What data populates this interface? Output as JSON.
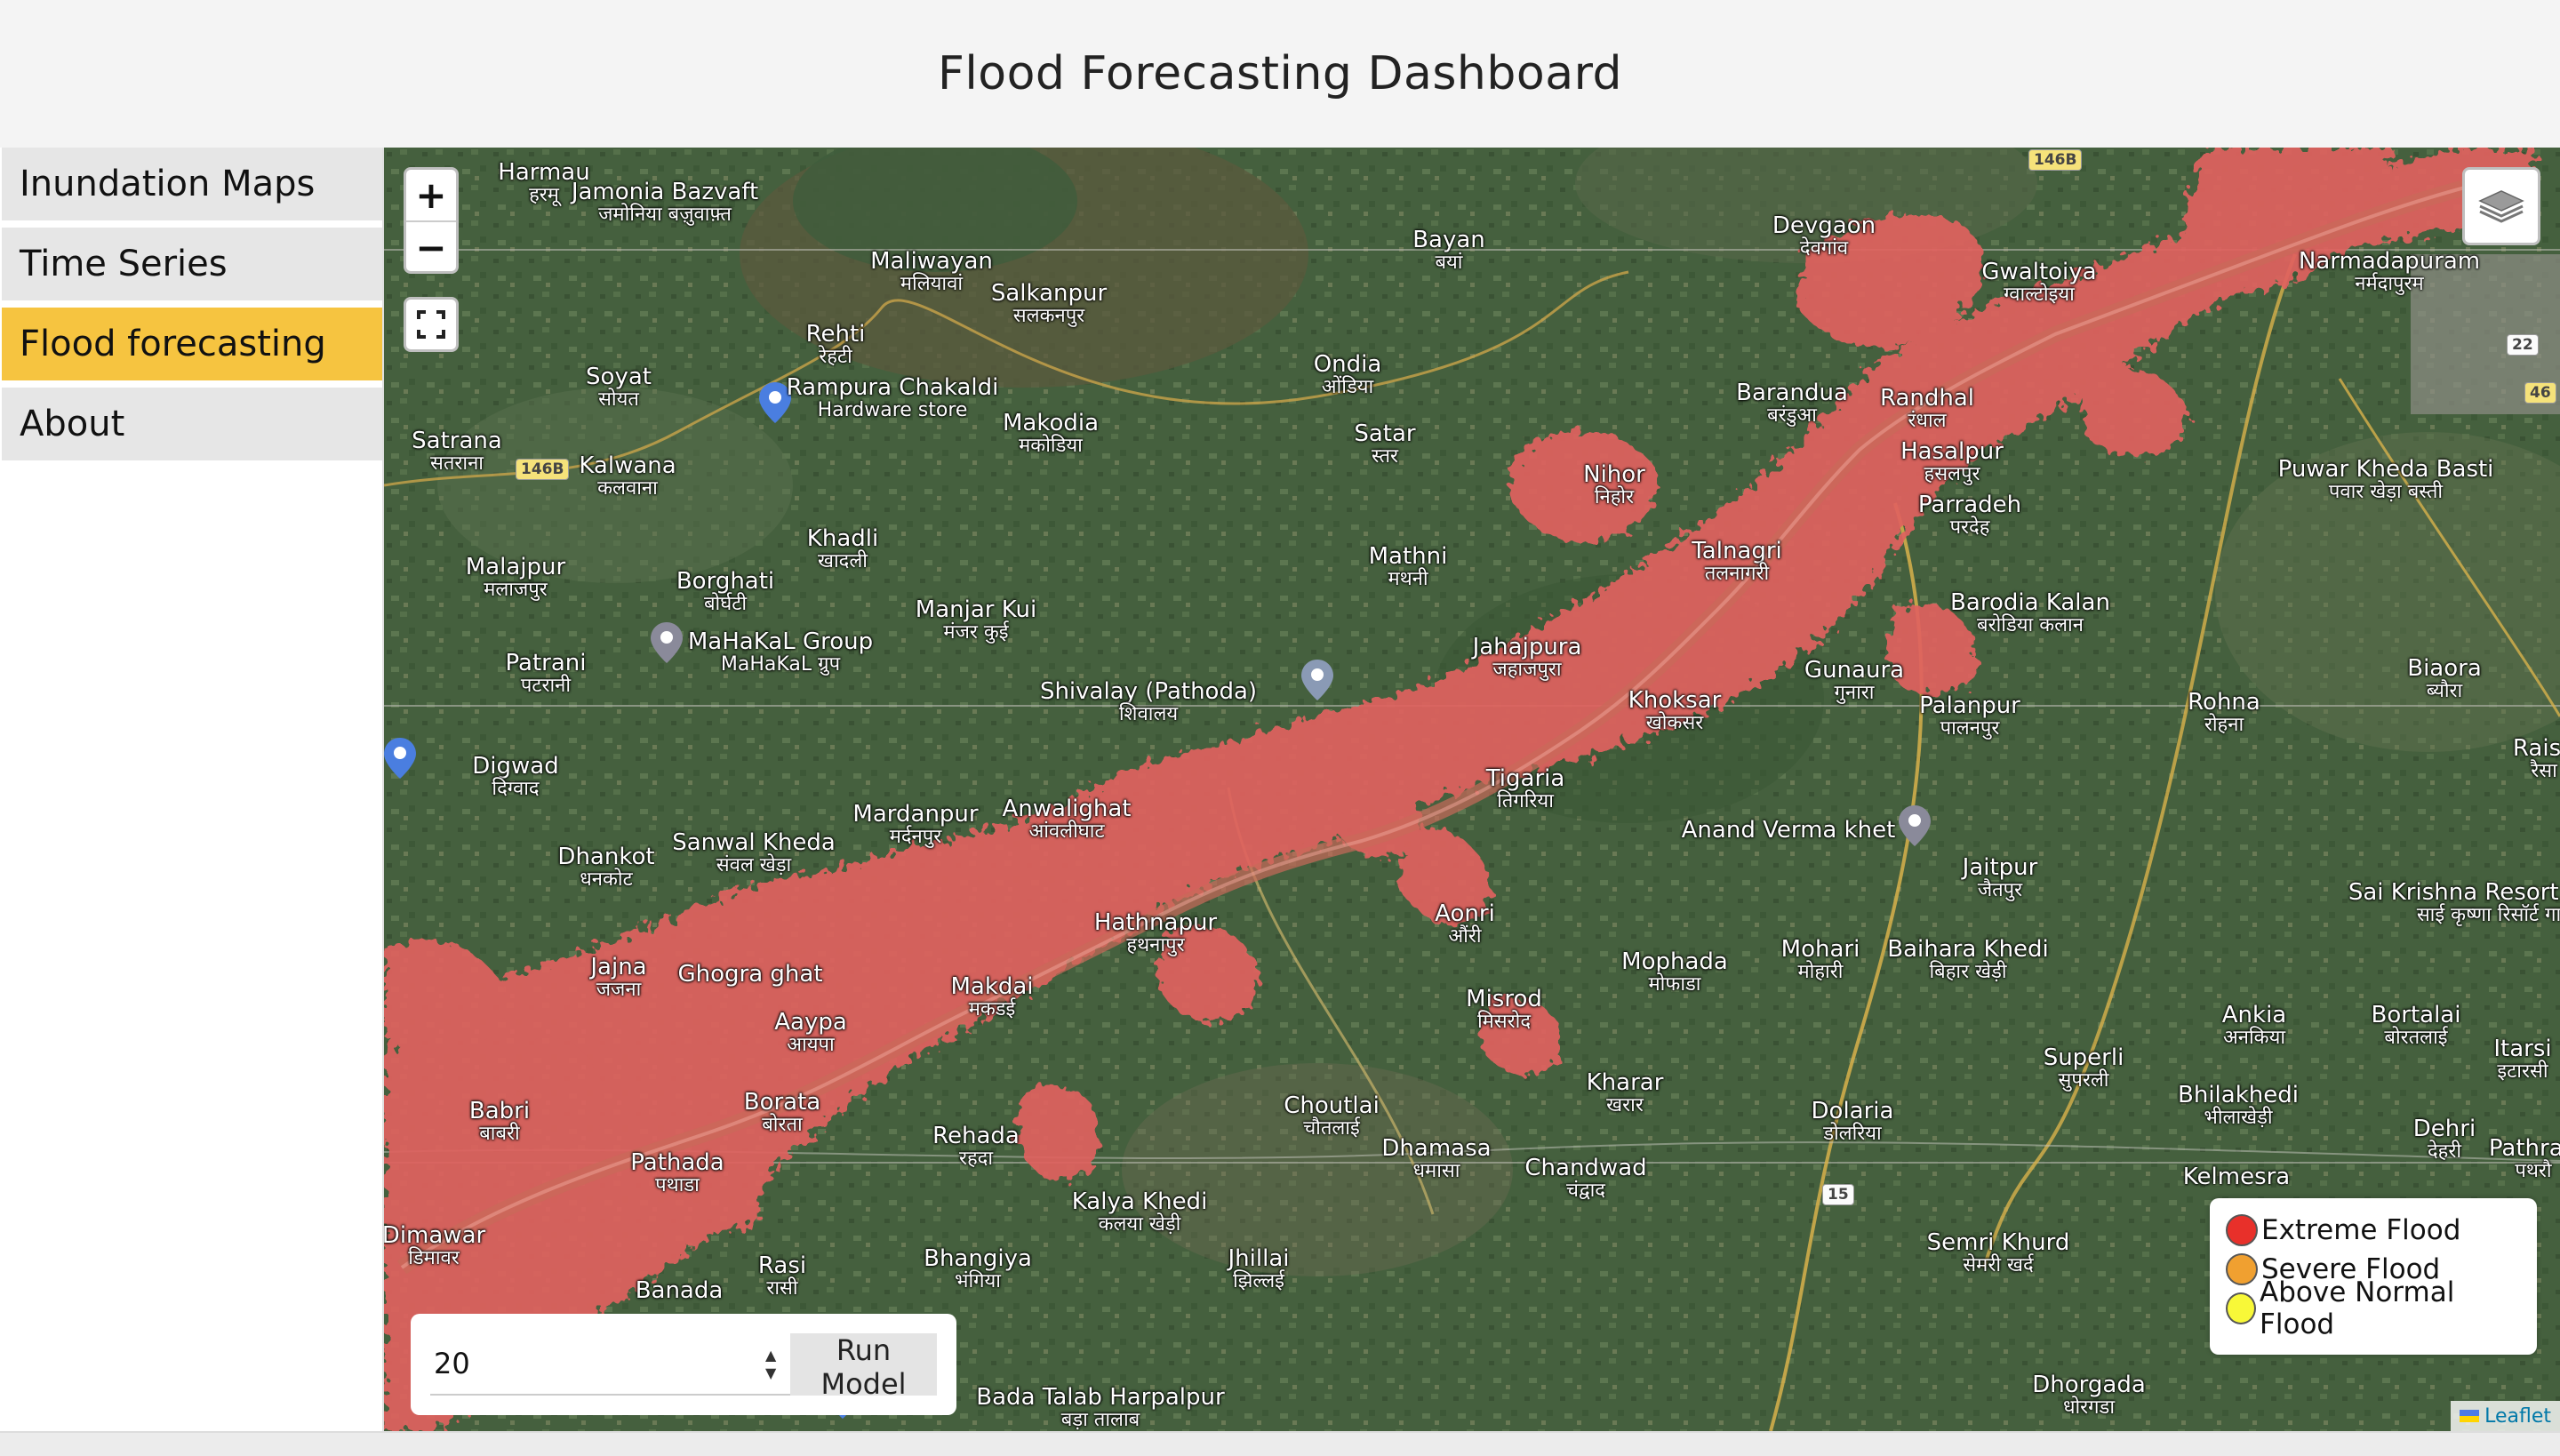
{
  "header": {
    "title": "Flood Forecasting Dashboard"
  },
  "sidebar": {
    "items": [
      {
        "label": "Inundation Maps",
        "active": false
      },
      {
        "label": "Time Series",
        "active": false
      },
      {
        "label": "Flood forecasting",
        "active": true
      },
      {
        "label": "About",
        "active": false
      }
    ]
  },
  "map": {
    "controls": {
      "zoom_in": "+",
      "zoom_out": "−",
      "fullscreen_icon": "fullscreen-icon",
      "layers_icon": "layers-icon"
    },
    "attribution": "Leaflet",
    "flood_color": "#e0625f",
    "places": [
      {
        "name": "Harmau",
        "local": "हरमू"
      },
      {
        "name": "Jamonia Bazvaft",
        "local": "जमोनिया बज़ुवाफ़्त"
      },
      {
        "name": "Maliwayan",
        "local": "मलियावां"
      },
      {
        "name": "Salkanpur",
        "local": "सलकनपुर"
      },
      {
        "name": "Rehti",
        "local": "रेहटी"
      },
      {
        "name": "Soyat",
        "local": "सोयत"
      },
      {
        "name": "Rampura Chakaldi",
        "local": "Hardware store"
      },
      {
        "name": "Makodia",
        "local": "मकोडिया"
      },
      {
        "name": "Satrana",
        "local": "सतराना"
      },
      {
        "name": "Kalwana",
        "local": "कलवाना"
      },
      {
        "name": "Bayan",
        "local": "बयां"
      },
      {
        "name": "Ondia",
        "local": "ओंडिया"
      },
      {
        "name": "Satar",
        "local": "स्तर"
      },
      {
        "name": "Devgaon",
        "local": "देवगांव"
      },
      {
        "name": "Gwaltoiya",
        "local": "ग्वाल्टोइया"
      },
      {
        "name": "Narmadapuram",
        "local": "नर्मदापुरम"
      },
      {
        "name": "Barandua",
        "local": "बरंडुआ"
      },
      {
        "name": "Randhal",
        "local": "रंधाल"
      },
      {
        "name": "Hasalpur",
        "local": "हसलपुर"
      },
      {
        "name": "Parradeh",
        "local": "परदेह"
      },
      {
        "name": "Puwar Kheda Basti",
        "local": "पवार खेड़ा बस्ती"
      },
      {
        "name": "Nihor",
        "local": "निहोर"
      },
      {
        "name": "Talnagri",
        "local": "तलनागरी"
      },
      {
        "name": "Mathni",
        "local": "मथनी"
      },
      {
        "name": "Khadli",
        "local": "खादली"
      },
      {
        "name": "Malajpur",
        "local": "मलाजपुर"
      },
      {
        "name": "Borghati",
        "local": "बोर्घटी"
      },
      {
        "name": "Manjar Kui",
        "local": "मंजर कुई"
      },
      {
        "name": "MaHaKaL Group",
        "local": "MaHaKaL ग्रुप"
      },
      {
        "name": "Patrani",
        "local": "पटरानी"
      },
      {
        "name": "Jahajpura",
        "local": "जहाजपुरा"
      },
      {
        "name": "Barodia Kalan",
        "local": "बरोडिया कलान"
      },
      {
        "name": "Gunaura",
        "local": "गुनारा"
      },
      {
        "name": "Shivalay (Pathoda)",
        "local": "शिवालय"
      },
      {
        "name": "Khoksar",
        "local": "खोकसर"
      },
      {
        "name": "Palanpur",
        "local": "पालनपुर"
      },
      {
        "name": "Rohna",
        "local": "रोहना"
      },
      {
        "name": "Biaora",
        "local": "ब्यौरा"
      },
      {
        "name": "Digwad",
        "local": "दिग्वाद"
      },
      {
        "name": "Tigaria",
        "local": "तिगरिया"
      },
      {
        "name": "Raisa",
        "local": "रैसा"
      },
      {
        "name": "Sanwal Kheda",
        "local": "संवल खेड़ा"
      },
      {
        "name": "Mardanpur",
        "local": "मर्दनपुर"
      },
      {
        "name": "Anwalighat",
        "local": "आंवलीघाट"
      },
      {
        "name": "Anand Verma khet",
        "local": ""
      },
      {
        "name": "Dhankot",
        "local": "धनकोट"
      },
      {
        "name": "Jaitpur",
        "local": "जैतपुर"
      },
      {
        "name": "Sai Krishna Resort Garden",
        "local": "साई कृष्णा रिसॉर्ट गार्डन"
      },
      {
        "name": "Hathnapur",
        "local": "हथनापुर"
      },
      {
        "name": "Aonri",
        "local": "औंरी"
      },
      {
        "name": "Baihara Khedi",
        "local": "बिहार खेड़ी"
      },
      {
        "name": "Jajna",
        "local": "जजना"
      },
      {
        "name": "Ghogra ghat",
        "local": ""
      },
      {
        "name": "Makdai",
        "local": "मकडई"
      },
      {
        "name": "Mophada",
        "local": "मोफाडा"
      },
      {
        "name": "Mohari",
        "local": "मोहारी"
      },
      {
        "name": "Misrod",
        "local": "मिसरोद"
      },
      {
        "name": "Aaypa",
        "local": "आयपा"
      },
      {
        "name": "Ankia",
        "local": "अनकिया"
      },
      {
        "name": "Bortalai",
        "local": "बोरतलाई"
      },
      {
        "name": "Superli",
        "local": "सुपरली"
      },
      {
        "name": "Itarsi",
        "local": "इटारसी"
      },
      {
        "name": "Babri",
        "local": "बाबरी"
      },
      {
        "name": "Borata",
        "local": "बोरता"
      },
      {
        "name": "Kharar",
        "local": "खरार"
      },
      {
        "name": "Bhilakhedi",
        "local": "भीलाखेड़ी"
      },
      {
        "name": "Choutlai",
        "local": "चौतलाई"
      },
      {
        "name": "Dolaria",
        "local": "डोलरिया"
      },
      {
        "name": "Dehri",
        "local": "देहरी"
      },
      {
        "name": "Pathrau",
        "local": "पथरौ"
      },
      {
        "name": "Rehada",
        "local": "रहदा"
      },
      {
        "name": "Pathada",
        "local": "पथाडा"
      },
      {
        "name": "Dhamasa",
        "local": "धमासा"
      },
      {
        "name": "Chandwad",
        "local": "चंद्वाद"
      },
      {
        "name": "Kalya Khedi",
        "local": "कलया खेड़ी"
      },
      {
        "name": "Kelmesra",
        "local": ""
      },
      {
        "name": "Dimawar",
        "local": "डिमावर"
      },
      {
        "name": "Jhillai",
        "local": "झिल्लई"
      },
      {
        "name": "Semri Khurd",
        "local": "सेमरी खर्द"
      },
      {
        "name": "Bhangiya",
        "local": "भंगिया"
      },
      {
        "name": "Rasi",
        "local": "रासी"
      },
      {
        "name": "Banada",
        "local": ""
      },
      {
        "name": "Bada Talab Harpalpur",
        "local": "बड़ा तालाब"
      },
      {
        "name": "Dhorgada",
        "local": "धोरगडा"
      }
    ],
    "roads": [
      "146B",
      "146B",
      "22",
      "46",
      "15"
    ]
  },
  "legend": {
    "items": [
      {
        "label": "Extreme Flood",
        "color": "#e8302a"
      },
      {
        "label": "Severe Flood",
        "color": "#f0a030"
      },
      {
        "label": "Above Normal Flood",
        "color": "#f8f838"
      }
    ]
  },
  "model": {
    "input_value": "20",
    "run_label": "Run Model"
  }
}
